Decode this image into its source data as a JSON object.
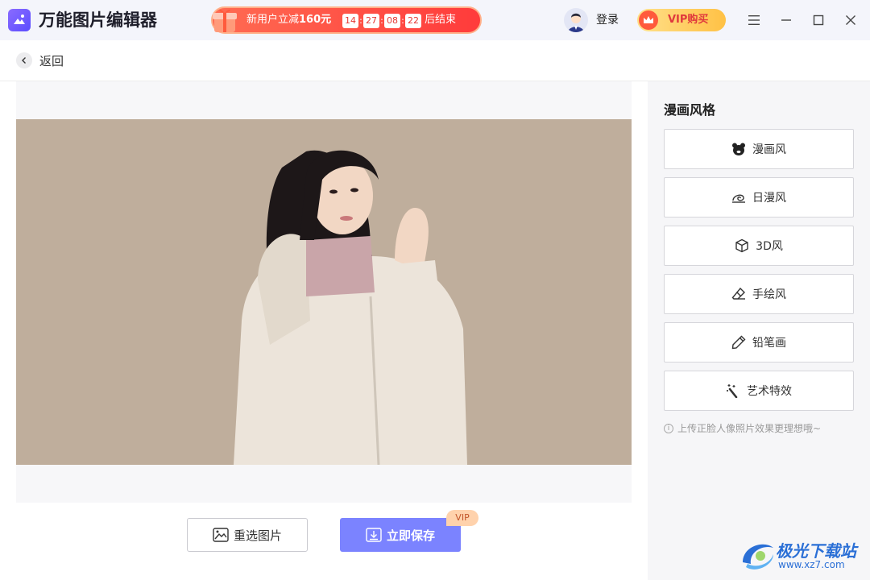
{
  "app": {
    "title": "万能图片编辑器",
    "accent": "#7b83ff"
  },
  "promo": {
    "text_prefix": "新用户立减",
    "amount": "160元",
    "timer": [
      "14",
      "27",
      "08",
      "22"
    ],
    "end_text": "后结束"
  },
  "user": {
    "login_label": "登录"
  },
  "vip": {
    "label": "VIP购买"
  },
  "window_controls": [
    "menu-icon",
    "minimize-icon",
    "maximize-icon",
    "close-icon"
  ],
  "nav": {
    "back_label": "返回"
  },
  "actions": {
    "reselect_label": "重选图片",
    "save_label": "立即保存",
    "vip_tag": "VIP"
  },
  "panel": {
    "title": "漫画风格",
    "styles": [
      {
        "label": "漫画风",
        "icon": "bear-icon"
      },
      {
        "label": "日漫风",
        "icon": "swirl-icon"
      },
      {
        "label": "3D风",
        "icon": "cube-icon"
      },
      {
        "label": "手绘风",
        "icon": "eraser-icon"
      },
      {
        "label": "铅笔画",
        "icon": "pencil-icon"
      },
      {
        "label": "艺术特效",
        "icon": "magic-wand-icon"
      }
    ],
    "hint": "上传正脸人像照片效果更理想哦~"
  },
  "watermark": {
    "title": "极光下载站",
    "url": "www.xz7.com"
  }
}
